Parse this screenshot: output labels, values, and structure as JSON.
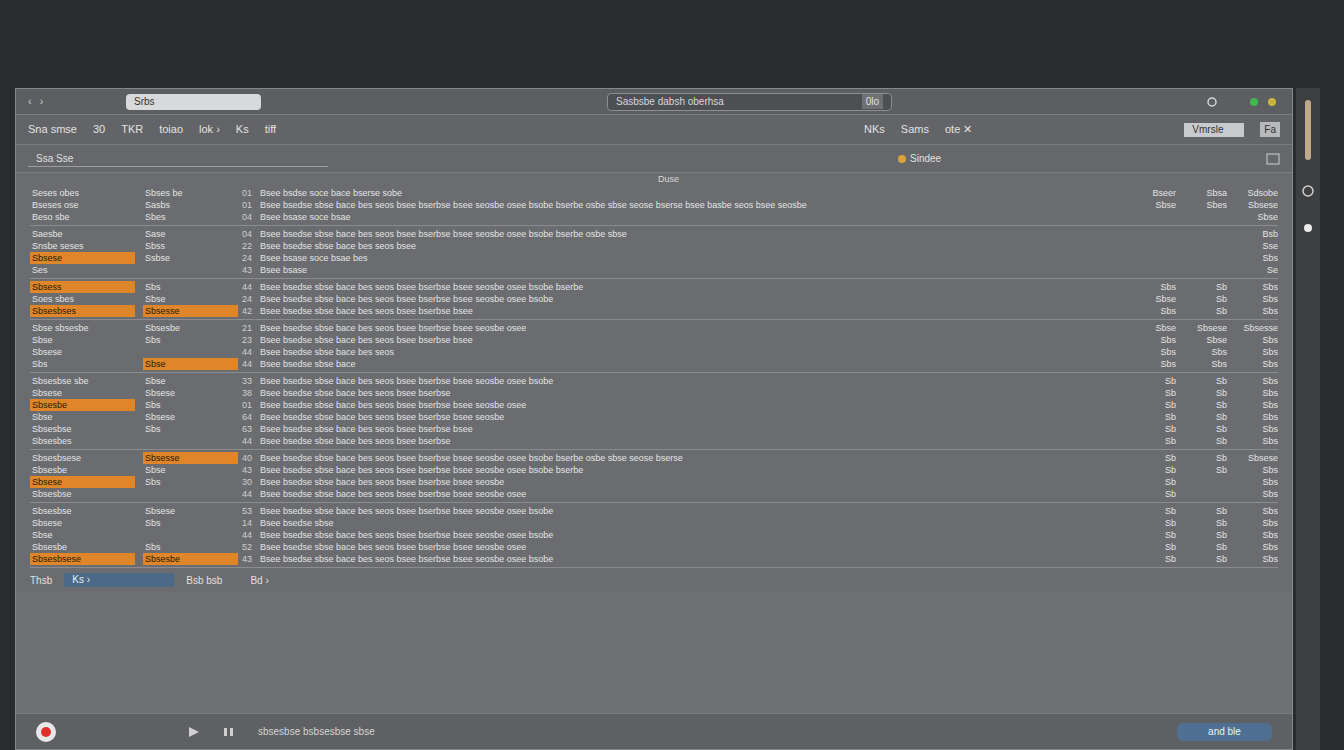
{
  "window": {
    "nav": [
      "‹",
      "›"
    ],
    "search": "Srbs",
    "address": "Sasbsbe dabsh oberhsa",
    "address_tag": "0lo",
    "lights": [
      {
        "color": "#3fb950"
      },
      {
        "color": "#c9b53a"
      }
    ]
  },
  "toolbar": {
    "items": [
      "Sna smse",
      "30",
      "TKR",
      "toiao",
      "lok ›",
      "Ks",
      "tiff"
    ],
    "right": [
      "NKs",
      "Sams",
      "ote ✕"
    ],
    "field": "Vmrsle",
    "end": "Fa"
  },
  "filter": {
    "field": "Ssa  Sse",
    "label": "Sindee",
    "dot": "#d9a23a"
  },
  "table": {
    "header": "Duse",
    "groups": [
      {
        "rows": [
          {
            "left": "Seses obes",
            "sub": "Sbses be",
            "n": "01",
            "text": "Bsee bsdse soce bace bserse sobe",
            "right": [
              "Bseer",
              "Sbsa",
              "Sdsobe"
            ],
            "highlight": false,
            "sub_highlight": false
          },
          {
            "left": "Bseses ose",
            "sub": "Sasbs",
            "n": "01",
            "text": "Bsee bsedse sbse bace bes seos bsee bserbse bsee seosbe osee bsobe bserbe osbe sbse seose bserse bsee basbe seos bsee seosbe",
            "right": [
              "Sbse",
              "Sbes",
              "Sbsese"
            ],
            "highlight": false,
            "sub_highlight": false
          },
          {
            "left": "Beso sbe",
            "sub": "Sbes",
            "n": "04",
            "text": "Bsee bsase soce bsae",
            "right": [
              "",
              "",
              "Sbse"
            ],
            "highlight": false,
            "sub_highlight": false
          }
        ]
      },
      {
        "rows": [
          {
            "left": "Saesbe",
            "sub": "Sase",
            "n": "04",
            "text": "Bsee bsedse sbse bace bes seos bsee bserbse bsee seosbe osee bsobe bserbe osbe sbse",
            "right": [
              "",
              "",
              "Bsb"
            ],
            "highlight": false,
            "sub_highlight": false
          },
          {
            "left": "Snsbe seses",
            "sub": "Sbss",
            "n": "22",
            "text": "Bsee bsedse sbse bace bes seos bsee",
            "right": [
              "",
              "",
              "Sse"
            ],
            "highlight": false,
            "sub_highlight": false
          },
          {
            "left": "Sbsese",
            "sub": "Ssbse",
            "n": "24",
            "text": "Bsee bsase soce bsae bes",
            "right": [
              "",
              "",
              "Sbs"
            ],
            "highlight": true,
            "sub_highlight": false
          },
          {
            "left": "Ses",
            "sub": "",
            "n": "43",
            "text": "Bsee bsase",
            "right": [
              "",
              "",
              "Se"
            ],
            "highlight": false,
            "sub_highlight": false
          }
        ]
      },
      {
        "rows": [
          {
            "left": "Sbsess",
            "sub": "Sbs",
            "n": "44",
            "text": "Bsee bsedse sbse bace bes seos bsee bserbse bsee seosbe osee bsobe bserbe",
            "right": [
              "Sbs",
              "Sb",
              "Sbs"
            ],
            "highlight": true,
            "sub_highlight": false
          },
          {
            "left": "Soes sbes",
            "sub": "Sbse",
            "n": "24",
            "text": "Bsee bsedse sbse bace bes seos bsee bserbse bsee seosbe osee bsobe",
            "right": [
              "Sbse",
              "Sb",
              "Sbs"
            ],
            "highlight": false,
            "sub_highlight": false
          },
          {
            "left": "Sbsesbses",
            "sub": "Sbsesse",
            "n": "42",
            "text": "Bsee bsedse sbse bace bes seos bsee bserbse bsee",
            "right": [
              "Sbs",
              "Sb",
              "Sbs"
            ],
            "highlight": true,
            "sub_highlight": true
          }
        ]
      },
      {
        "rows": [
          {
            "left": "Sbse sbsesbe",
            "sub": "Sbsesbe",
            "n": "21",
            "text": "Bsee bsedse sbse bace bes seos bsee bserbse bsee seosbe osee",
            "right": [
              "Sbse",
              "Sbsese",
              "Sbsesse"
            ],
            "highlight": false,
            "sub_highlight": false
          },
          {
            "left": "Sbse",
            "sub": "Sbs",
            "n": "23",
            "text": "Bsee bsedse sbse bace bes seos bsee bserbse bsee",
            "right": [
              "Sbs",
              "Sbse",
              "Sbs"
            ],
            "highlight": false,
            "sub_highlight": false
          },
          {
            "left": "Sbsese",
            "sub": "",
            "n": "44",
            "text": "Bsee bsedse sbse bace bes seos",
            "right": [
              "Sbs",
              "Sbs",
              "Sbs"
            ],
            "highlight": false,
            "sub_highlight": false
          },
          {
            "left": "Sbs",
            "sub": "Sbse",
            "n": "44",
            "text": "Bsee bsedse sbse bace",
            "right": [
              "Sbs",
              "Sbs",
              "Sbs"
            ],
            "highlight": false,
            "sub_highlight": true
          }
        ]
      },
      {
        "rows": [
          {
            "left": "Sbsesbse sbe",
            "sub": "Sbse",
            "n": "33",
            "text": "Bsee bsedse sbse bace bes seos bsee bserbse bsee seosbe osee bsobe",
            "right": [
              "Sb",
              "Sb",
              "Sbs"
            ],
            "highlight": false,
            "sub_highlight": false
          },
          {
            "left": "Sbsese",
            "sub": "Sbsese",
            "n": "38",
            "text": "Bsee bsedse sbse bace bes seos bsee bserbse",
            "right": [
              "Sb",
              "Sb",
              "Sbs"
            ],
            "highlight": false,
            "sub_highlight": false
          },
          {
            "left": "Sbsesbe",
            "sub": "Sbs",
            "n": "01",
            "text": "Bsee bsedse sbse bace bes seos bsee bserbse bsee seosbe osee",
            "right": [
              "Sb",
              "Sb",
              "Sbs"
            ],
            "highlight": true,
            "sub_highlight": false
          },
          {
            "left": "Sbse",
            "sub": "Sbsese",
            "n": "64",
            "text": "Bsee bsedse sbse bace bes seos bsee bserbse bsee seosbe",
            "right": [
              "Sb",
              "Sb",
              "Sbs"
            ],
            "highlight": false,
            "sub_highlight": false
          },
          {
            "left": "Sbsesbse",
            "sub": "Sbs",
            "n": "63",
            "text": "Bsee bsedse sbse bace bes seos bsee bserbse bsee",
            "right": [
              "Sb",
              "Sb",
              "Sbs"
            ],
            "highlight": false,
            "sub_highlight": false
          },
          {
            "left": "Sbsesbes",
            "sub": "",
            "n": "44",
            "text": "Bsee bsedse sbse bace bes seos bsee bserbse",
            "right": [
              "Sb",
              "Sb",
              "Sbs"
            ],
            "highlight": false,
            "sub_highlight": false
          }
        ]
      },
      {
        "rows": [
          {
            "left": "Sbsesbsese",
            "sub": "Sbsesse",
            "n": "40",
            "text": "Bsee bsedse sbse bace bes seos bsee bserbse bsee seosbe osee bsobe bserbe osbe sbse seose bserse",
            "right": [
              "Sb",
              "Sb",
              "Sbsese"
            ],
            "highlight": false,
            "sub_highlight": true
          },
          {
            "left": "Sbsesbe",
            "sub": "Sbse",
            "n": "43",
            "text": "Bsee bsedse sbse bace bes seos bsee bserbse bsee seosbe osee bsobe bserbe",
            "right": [
              "Sb",
              "Sb",
              "Sbs"
            ],
            "highlight": false,
            "sub_highlight": false
          },
          {
            "left": "Sbsese",
            "sub": "Sbs",
            "n": "30",
            "text": "Bsee bsedse sbse bace bes seos bsee bserbse bsee seosbe",
            "right": [
              "Sb",
              "",
              "Sbs"
            ],
            "highlight": true,
            "sub_highlight": false
          },
          {
            "left": "Sbsesbse",
            "sub": "",
            "n": "44",
            "text": "Bsee bsedse sbse bace bes seos bsee bserbse bsee seosbe osee",
            "right": [
              "Sb",
              "",
              "Sbs"
            ],
            "highlight": false,
            "sub_highlight": false
          }
        ]
      },
      {
        "rows": [
          {
            "left": "Sbsesbse",
            "sub": "Sbsese",
            "n": "53",
            "text": "Bsee bsedse sbse bace bes seos bsee bserbse bsee seosbe osee bsobe",
            "right": [
              "Sb",
              "Sb",
              "Sbs"
            ],
            "highlight": false,
            "sub_highlight": false
          },
          {
            "left": "Sbsese",
            "sub": "Sbs",
            "n": "14",
            "text": "Bsee bsedse sbse",
            "right": [
              "Sb",
              "Sb",
              "Sbs"
            ],
            "highlight": false,
            "sub_highlight": false
          },
          {
            "left": "Sbse",
            "sub": "",
            "n": "44",
            "text": "Bsee bsedse sbse bace bes seos bsee bserbse bsee seosbe osee bsobe",
            "right": [
              "Sb",
              "Sb",
              "Sbs"
            ],
            "highlight": false,
            "sub_highlight": false
          },
          {
            "left": "Sbsesbe",
            "sub": "Sbs",
            "n": "52",
            "text": "Bsee bsedse sbse bace bes seos bsee bserbse bsee seosbe osee",
            "right": [
              "Sb",
              "Sb",
              "Sbs"
            ],
            "highlight": false,
            "sub_highlight": false
          },
          {
            "left": "Sbsesbsese",
            "sub": "Sbsesbe",
            "n": "43",
            "text": "Bsee bsedse sbse bace bes seos bsee bserbse bsee seosbe osee bsobe",
            "right": [
              "Sb",
              "Sb",
              "Sbs"
            ],
            "highlight": true,
            "sub_highlight": true
          }
        ]
      }
    ]
  },
  "footer": {
    "label": "Thsb",
    "field": "Ks ›",
    "tag": "Bsb bsb",
    "end": "Bd ›"
  },
  "bottom_bar": {
    "recording": true,
    "status": "sbsesbse bsbsesbse sbse",
    "button": "and ble"
  }
}
